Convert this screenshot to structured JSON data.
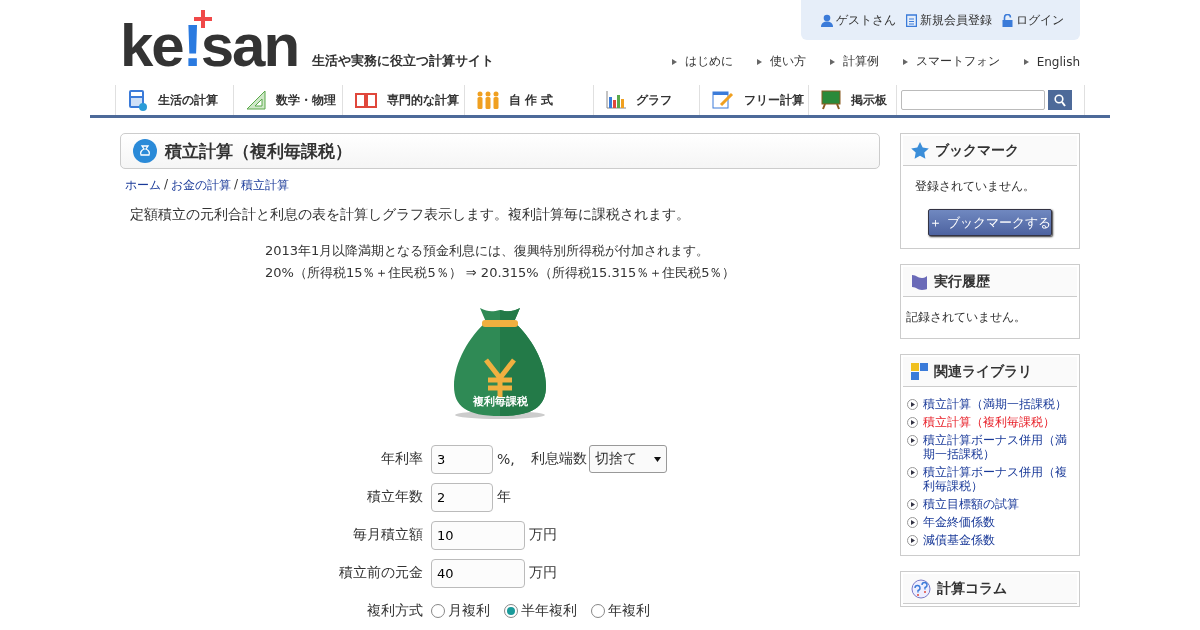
{
  "logo": {
    "parts": [
      "ke",
      "!",
      "san"
    ],
    "tagline": "生活や実務に役立つ計算サイト"
  },
  "user_menu": [
    {
      "kind": "user",
      "label": "ゲストさん"
    },
    {
      "kind": "register",
      "label": "新規会員登録"
    },
    {
      "kind": "login",
      "label": "ログイン"
    }
  ],
  "header_links": [
    "はじめに",
    "使い方",
    "計算例",
    "スマートフォン",
    "English"
  ],
  "nav": [
    {
      "kind": "calc",
      "label": "生活の計算"
    },
    {
      "kind": "ruler",
      "label": "数学・物理"
    },
    {
      "kind": "book",
      "label": "専門的な計算"
    },
    {
      "kind": "people",
      "label": "自 作 式"
    },
    {
      "kind": "chart",
      "label": "グラフ"
    },
    {
      "kind": "pencil",
      "label": "フリー計算"
    },
    {
      "kind": "board",
      "label": "掲示板"
    }
  ],
  "page_title": "積立計算（複利毎課税）",
  "breadcrumb": [
    {
      "kind": "link",
      "text": "ホーム"
    },
    {
      "kind": "separator",
      "text": "/"
    },
    {
      "kind": "link",
      "text": "お金の計算"
    },
    {
      "kind": "separator",
      "text": "/"
    },
    {
      "kind": "link",
      "text": "積立計算"
    }
  ],
  "description": "定額積立の元利合計と利息の表を計算しグラフ表示します。複利計算毎に課税されます。",
  "notice": [
    "2013年1月以降満期となる預金利息には、復興特別所得税が付加されます。",
    "20%（所得税15％＋住民税5％） ⇒ 20.315%（所得税15.315％＋住民税5％）"
  ],
  "illustration_label": "複利毎課税",
  "form": [
    {
      "kind": "input",
      "label": "年利率",
      "value": "3",
      "unit": "%,",
      "extra_label": "利息端数",
      "select": "切捨て"
    },
    {
      "kind": "input",
      "label": "積立年数",
      "value": "2",
      "unit": "年"
    },
    {
      "kind": "input",
      "label": "毎月積立額",
      "value": "10",
      "unit": "万円"
    },
    {
      "kind": "input",
      "label": "積立前の元金",
      "value": "40",
      "unit": "万円"
    },
    {
      "kind": "radio",
      "label": "複利方式",
      "options": [
        {
          "label": "月複利",
          "selected": false
        },
        {
          "label": "半年複利",
          "selected": true
        },
        {
          "label": "年複利",
          "selected": false
        }
      ]
    }
  ],
  "sidebar": [
    {
      "kind": "bookmark",
      "title": "ブックマーク",
      "text": "登録されていません。",
      "button": "＋ ブックマークする"
    },
    {
      "kind": "history",
      "title": "実行履歴",
      "text": "記録されていません。"
    },
    {
      "kind": "library",
      "title": "関連ライブラリ",
      "links": [
        {
          "label": "積立計算（満期一括課税）",
          "selected": false
        },
        {
          "label": "積立計算（複利毎課税）",
          "selected": true
        },
        {
          "label": "積立計算ボーナス併用（満期一括課税）",
          "selected": false
        },
        {
          "label": "積立計算ボーナス併用（複利毎課税）",
          "selected": false
        },
        {
          "label": "積立目標額の試算",
          "selected": false
        },
        {
          "label": "年金終価係数",
          "selected": false
        },
        {
          "label": "減債基金係数",
          "selected": false
        }
      ]
    },
    {
      "kind": "column",
      "title": "計算コラム"
    }
  ]
}
